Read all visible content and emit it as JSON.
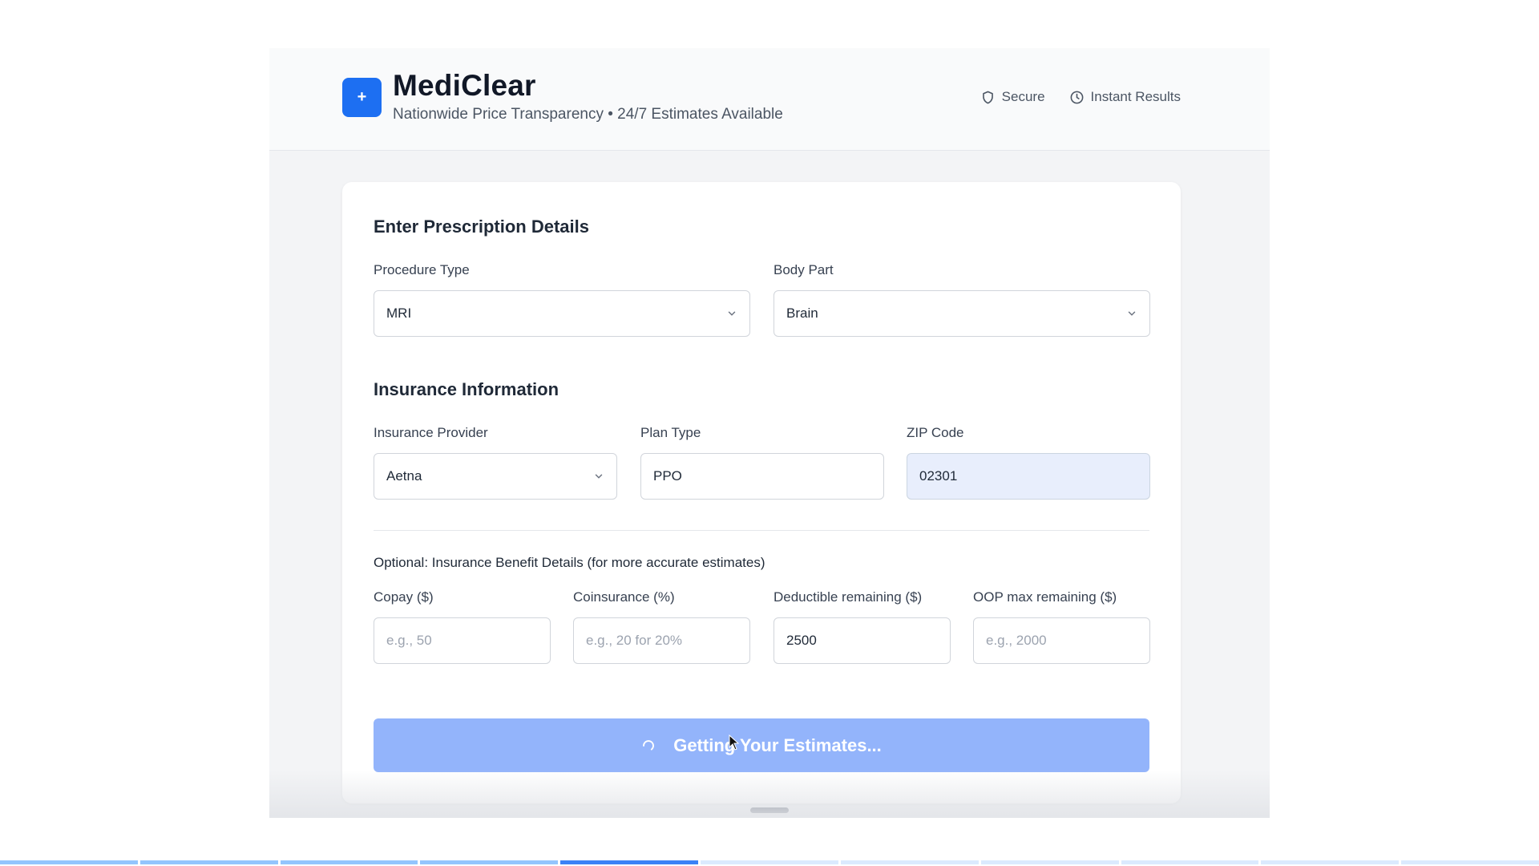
{
  "header": {
    "logo_glyph": "+",
    "title": "MediClear",
    "subtitle": "Nationwide Price Transparency • 24/7 Estimates Available",
    "badges": [
      {
        "label": "Secure",
        "icon": "shield-icon"
      },
      {
        "label": "Instant Results",
        "icon": "clock-icon"
      }
    ]
  },
  "prescription": {
    "title": "Enter Prescription Details",
    "procedure_type": {
      "label": "Procedure Type",
      "value": "MRI"
    },
    "body_part": {
      "label": "Body Part",
      "value": "Brain"
    }
  },
  "insurance": {
    "title": "Insurance Information",
    "provider": {
      "label": "Insurance Provider",
      "value": "Aetna"
    },
    "plan_type": {
      "label": "Plan Type",
      "value": "PPO"
    },
    "zip": {
      "label": "ZIP Code",
      "value": "02301"
    }
  },
  "benefits": {
    "note": "Optional: Insurance Benefit Details (for more accurate estimates)",
    "copay": {
      "label": "Copay ($)",
      "value": "",
      "placeholder": "e.g., 50"
    },
    "coinsurance": {
      "label": "Coinsurance (%)",
      "value": "",
      "placeholder": "e.g., 20 for 20%"
    },
    "deductible": {
      "label": "Deductible remaining ($)",
      "value": "2500",
      "placeholder": ""
    },
    "oop_max": {
      "label": "OOP max remaining ($)",
      "value": "",
      "placeholder": "e.g., 2000"
    }
  },
  "submit": {
    "label": "Getting Your Estimates...",
    "loading": true
  },
  "progress": {
    "segments": 11,
    "completed": 4,
    "active_index": 4
  },
  "colors": {
    "accent": "#1d6ff2",
    "button_loading": "#93b4fb",
    "field_filled": "#e8eefc"
  }
}
